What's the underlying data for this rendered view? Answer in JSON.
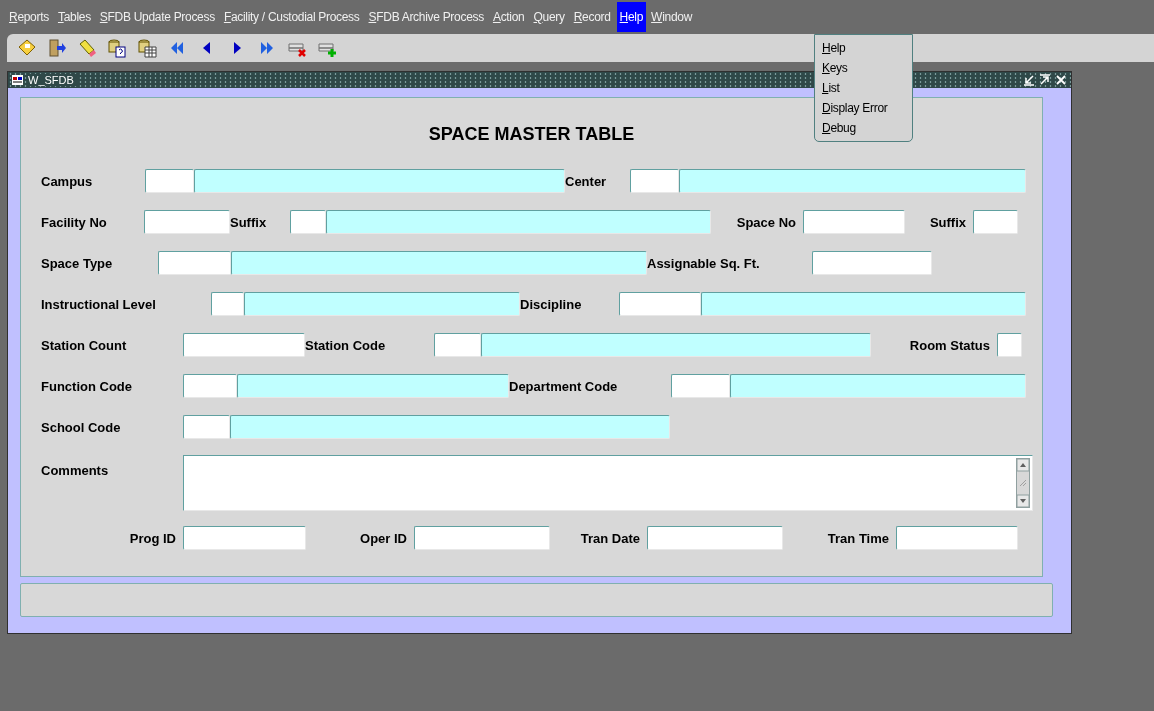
{
  "menu_bar": [
    {
      "label": "Reports",
      "selected": false
    },
    {
      "label": "Tables",
      "selected": false
    },
    {
      "label": "SFDB Update Process",
      "selected": false
    },
    {
      "label": "Facility / Custodial Process",
      "selected": false
    },
    {
      "label": "SFDB Archive Process",
      "selected": false
    },
    {
      "label": "Action",
      "selected": false
    },
    {
      "label": "Query",
      "selected": false
    },
    {
      "label": "Record",
      "selected": false
    },
    {
      "label": "Help",
      "selected": true
    },
    {
      "label": "Window",
      "selected": false
    }
  ],
  "toolbar": [
    {
      "kind": "save"
    },
    {
      "kind": "exit"
    },
    {
      "kind": "clear"
    },
    {
      "kind": "query"
    },
    {
      "kind": "table"
    },
    {
      "kind": "first"
    },
    {
      "kind": "prev"
    },
    {
      "kind": "next"
    },
    {
      "kind": "last"
    },
    {
      "kind": "delete"
    },
    {
      "kind": "insert"
    }
  ],
  "help_menu": [
    {
      "label": "Help"
    },
    {
      "label": "Keys"
    },
    {
      "label": "List"
    },
    {
      "label": "Display Error"
    },
    {
      "label": "Debug"
    }
  ],
  "window": {
    "title": "W_SFDB"
  },
  "form": {
    "title": "SPACE MASTER TABLE",
    "lines": [
      {
        "items": [
          {
            "kind": "label",
            "text": "Campus"
          },
          {
            "kind": "input"
          },
          {
            "kind": "display"
          },
          {
            "kind": "label",
            "text": "Center"
          },
          {
            "kind": "input"
          },
          {
            "kind": "display"
          }
        ]
      },
      {
        "items": [
          {
            "kind": "label",
            "text": "Facility No"
          },
          {
            "kind": "input"
          },
          {
            "kind": "label",
            "text": "Suffix"
          },
          {
            "kind": "input"
          },
          {
            "kind": "display"
          },
          {
            "kind": "label",
            "text": "Space No"
          },
          {
            "kind": "input"
          },
          {
            "kind": "label",
            "text": "Suffix"
          },
          {
            "kind": "input"
          }
        ]
      },
      {
        "items": [
          {
            "kind": "label",
            "text": "Space Type"
          },
          {
            "kind": "input"
          },
          {
            "kind": "display"
          },
          {
            "kind": "label",
            "text": "Assignable Sq. Ft."
          },
          {
            "kind": "input"
          }
        ]
      },
      {
        "items": [
          {
            "kind": "label",
            "text": "Instructional Level"
          },
          {
            "kind": "input"
          },
          {
            "kind": "display"
          },
          {
            "kind": "label",
            "text": "Discipline"
          },
          {
            "kind": "input"
          },
          {
            "kind": "display"
          }
        ]
      },
      {
        "items": [
          {
            "kind": "label",
            "text": "Station Count"
          },
          {
            "kind": "input"
          },
          {
            "kind": "label",
            "text": "Station Code"
          },
          {
            "kind": "input"
          },
          {
            "kind": "display"
          },
          {
            "kind": "label",
            "text": "Room Status"
          },
          {
            "kind": "input"
          }
        ]
      },
      {
        "items": [
          {
            "kind": "label",
            "text": "Function Code"
          },
          {
            "kind": "input"
          },
          {
            "kind": "display"
          },
          {
            "kind": "label",
            "text": "Department Code"
          },
          {
            "kind": "input"
          },
          {
            "kind": "display"
          }
        ]
      },
      {
        "items": [
          {
            "kind": "label",
            "text": "School Code"
          },
          {
            "kind": "input"
          },
          {
            "kind": "display"
          }
        ]
      },
      {
        "items": [
          {
            "kind": "label",
            "text": "Comments"
          },
          {
            "kind": "textarea"
          }
        ]
      },
      {
        "items": [
          {
            "kind": "label",
            "text": "Prog ID"
          },
          {
            "kind": "input"
          },
          {
            "kind": "label",
            "text": "Oper ID"
          },
          {
            "kind": "input"
          },
          {
            "kind": "label",
            "text": "Tran Date"
          },
          {
            "kind": "input"
          },
          {
            "kind": "label",
            "text": "Tran Time"
          },
          {
            "kind": "input"
          }
        ]
      }
    ]
  }
}
